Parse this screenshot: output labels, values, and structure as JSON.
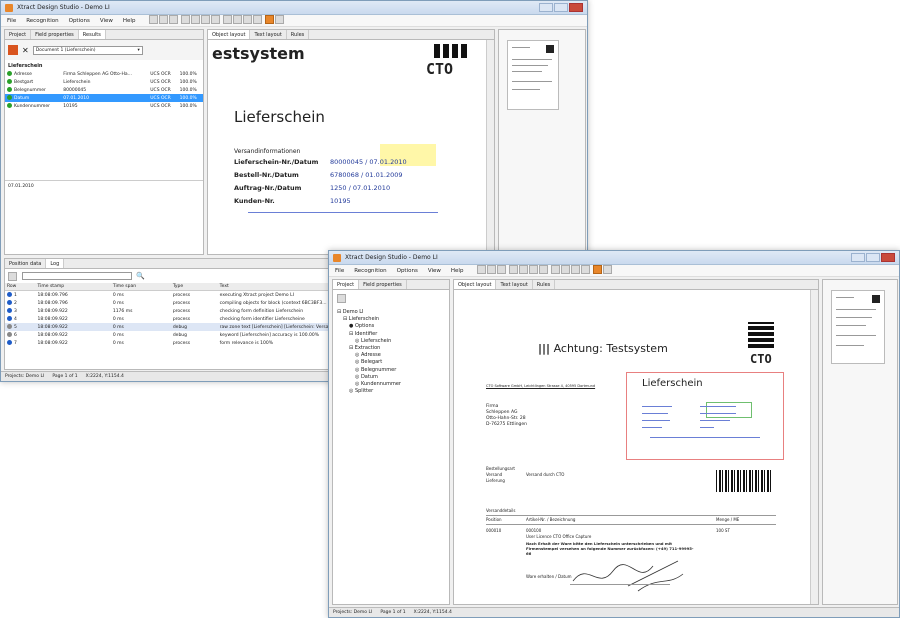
{
  "window1": {
    "title": "Xtract Design Studio - Demo LI",
    "menu": [
      "File",
      "Recognition",
      "Options",
      "View",
      "Help"
    ],
    "left_tabs": [
      "Project",
      "Field properties",
      "Results"
    ],
    "document_select": "Document 1 (Lieferschein)",
    "results_header": "Lieferschein",
    "results": [
      {
        "field": "Adresse",
        "value": "Firma Schleppen AG Otto-Ha...",
        "source": "UCS OCR",
        "conf": "100.0%"
      },
      {
        "field": "Bestgart",
        "value": "Lieferschein",
        "source": "UCS OCR",
        "conf": "100.0%"
      },
      {
        "field": "Belegnummer",
        "value": "80000045",
        "source": "UCS OCR",
        "conf": "100.0%"
      },
      {
        "field": "Datum",
        "value": "07.01.2010",
        "source": "UCS OCR",
        "conf": "100.0%"
      },
      {
        "field": "Kundennummer",
        "value": "10195",
        "source": "UCS OCR",
        "conf": "100.0%"
      }
    ],
    "result_detail": "07.01.2010",
    "doc_tabs": [
      "Object layout",
      "Text layout",
      "Rules"
    ],
    "doc": {
      "banner": "estsystem",
      "logo": "CTO",
      "heading": "Lieferschein",
      "section": "Versandinformationen",
      "rows": [
        {
          "label": "Lieferschein-Nr./Datum",
          "value": "80000045 / 07.01.2010"
        },
        {
          "label": "Bestell-Nr./Datum",
          "value": "6780068 / 01.01.2009"
        },
        {
          "label": "Auftrag-Nr./Datum",
          "value": "1250 / 07.01.2010"
        },
        {
          "label": "Kunden-Nr.",
          "value": "10195"
        }
      ]
    },
    "log_tabs": [
      "Position data",
      "Log"
    ],
    "log_headers": [
      "Row",
      "Time stamp",
      "Time span",
      "Type",
      "Text"
    ],
    "log_rows": [
      {
        "row": "1",
        "time": "18:08:09.796",
        "span": "0 ms",
        "type": "process",
        "text": "executing Xtract project Demo LI"
      },
      {
        "row": "2",
        "time": "18:08:09.796",
        "span": "0 ms",
        "type": "process",
        "text": "compiling objects for block (context 6BC3BF3... )"
      },
      {
        "row": "3",
        "time": "18:08:09.922",
        "span": "1176 ms",
        "type": "process",
        "text": "checking form definition Lieferschein"
      },
      {
        "row": "4",
        "time": "18:08:09.922",
        "span": "0 ms",
        "type": "process",
        "text": "checking form identifier Lieferscheine"
      },
      {
        "row": "5",
        "time": "18:08:09.922",
        "span": "0 ms",
        "type": "debug",
        "text": "raw zone text [Lieferschein] [Lieferschein: Versandinformationen: Lief...]"
      },
      {
        "row": "6",
        "time": "18:08:09.922",
        "span": "0 ms",
        "type": "debug",
        "text": "keyword [Lieferschein] accuracy is 100.00%"
      },
      {
        "row": "7",
        "time": "18:08:09.922",
        "span": "0 ms",
        "type": "process",
        "text": "form relevance is 100%"
      }
    ],
    "status": [
      "Projects: Demo LI",
      "Page 1 of 1",
      "X:2224, Y:1154.4"
    ]
  },
  "window2": {
    "title": "Xtract Design Studio - Demo LI",
    "menu": [
      "File",
      "Recognition",
      "Options",
      "View",
      "Help"
    ],
    "left_tabs": [
      "Project",
      "Field properties"
    ],
    "tree": [
      {
        "label": "Demo LI",
        "level": 0
      },
      {
        "label": "Lieferschein",
        "level": 1
      },
      {
        "label": "Options",
        "level": 2
      },
      {
        "label": "Identifier",
        "level": 2
      },
      {
        "label": "Lieferschein",
        "level": 3
      },
      {
        "label": "Extraction",
        "level": 2
      },
      {
        "label": "Adresse",
        "level": 3
      },
      {
        "label": "Belegart",
        "level": 3
      },
      {
        "label": "Belegnummer",
        "level": 3
      },
      {
        "label": "Datum",
        "level": 3
      },
      {
        "label": "Kundennummer",
        "level": 3
      },
      {
        "label": "Splitter",
        "level": 2
      }
    ],
    "doc_tabs": [
      "Object layout",
      "Text layout",
      "Rules"
    ],
    "doc": {
      "banner": "Achtung: Testsystem",
      "logo": "CTO",
      "heading": "Lieferschein",
      "sender_line": "CTO Software GmbH, Leichtlingen Strasse 4, 40595 Dortmund",
      "address": [
        "Firma",
        "Schleppen AG",
        "Otto-Hahn-Str. 28",
        "D-76275 Ettlingen"
      ],
      "meta_labels": [
        "Bestellungsart",
        "Versand",
        "Lieferung"
      ],
      "meta_value": "Versand durch CTO",
      "section": "Versanddetails",
      "table_headers": [
        "Position",
        "Artikel-Nr. / Bezeichnung",
        "Menge / ME"
      ],
      "item": {
        "pos": "000010",
        "nr": "000100",
        "desc": "User Licence CTO Office Capture",
        "qty": "100 ST"
      },
      "note": "Nach Erhalt der Ware bitte den Lieferschein unterschrieben und mit Firmenstempel versehen an folgende Nummer zurückfaxen: (+49) 711-99995-66",
      "signature_label": "Ware erhalten / Datum"
    },
    "status": [
      "Projects: Demo LI",
      "Page 1 of 1",
      "X:2224, Y:1154.4"
    ]
  }
}
